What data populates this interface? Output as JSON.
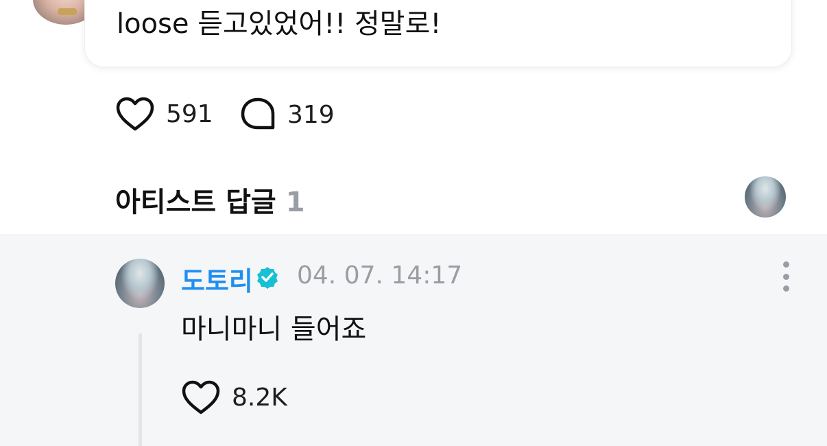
{
  "post": {
    "text": "loose 듣고있었어!! 정말로!",
    "likes": "591",
    "comments": "319"
  },
  "artist_replies": {
    "title": "아티스트 답글",
    "count": "1"
  },
  "reply": {
    "author": "도토리",
    "timestamp": "04. 07. 14:17",
    "text": "마니마니 들어죠",
    "likes": "8.2K"
  },
  "colors": {
    "author": "#1f8ef1",
    "verified": "#17c1d3",
    "muted": "#9a9da3",
    "panel": "#f5f6f8"
  },
  "icons": {
    "like": "heart-icon",
    "comment": "speech-bubble-icon",
    "verified": "verified-badge-icon",
    "more": "more-vertical-icon"
  }
}
